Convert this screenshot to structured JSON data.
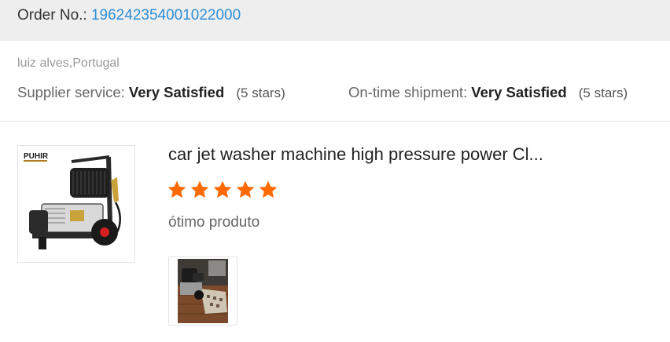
{
  "order": {
    "label": "Order No.:",
    "number": "196242354001022000",
    "link_color": "#2d8fd6"
  },
  "reviewer": {
    "name_country": "luiz alves,Portugal"
  },
  "ratings": {
    "supplier_service": {
      "label": "Supplier service:",
      "value": "Very Satisfied",
      "stars_text": "(5 stars)"
    },
    "ontime_shipment": {
      "label": "On-time shipment:",
      "value": "Very Satisfied",
      "stars_text": "(5 stars)"
    }
  },
  "product": {
    "title": "car jet washer machine high pressure power Cl...",
    "thumbnail_icon": "pressure-washer-image",
    "thumbnail_brand": "PUHIR"
  },
  "review": {
    "stars": 5,
    "star_color": "#ff6a00",
    "comment": "ótimo produto",
    "photo_icon": "customer-photo-image"
  }
}
